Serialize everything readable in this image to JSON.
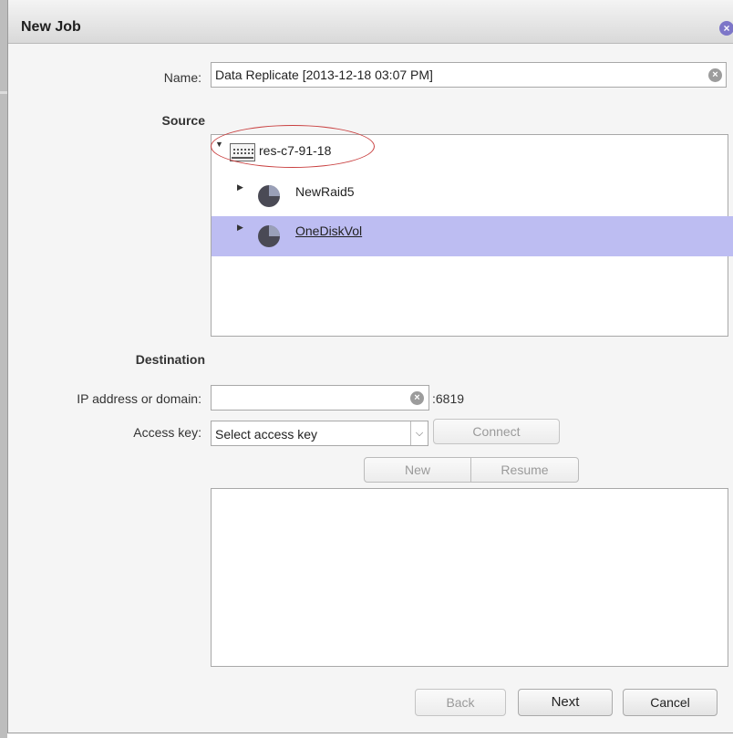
{
  "dialog": {
    "title": "New Job"
  },
  "name_field": {
    "label": "Name:",
    "value": "Data Replicate [2013-12-18 03:07 PM]"
  },
  "source": {
    "heading": "Source",
    "host": "res-c7-91-18",
    "volumes": [
      {
        "label": "NewRaid5",
        "selected": false
      },
      {
        "label": "OneDiskVol",
        "selected": true
      }
    ]
  },
  "destination": {
    "heading": "Destination",
    "ip_label": "IP address or domain:",
    "ip_value": "",
    "port": ":6819",
    "access_key_label": "Access key:",
    "access_key_selected": "Select access key",
    "connect_label": "Connect",
    "new_label": "New",
    "resume_label": "Resume"
  },
  "footer": {
    "back_label": "Back",
    "next_label": "Next",
    "cancel_label": "Cancel"
  },
  "colors": {
    "selection": "#bdbdf2",
    "close_icon": "#7d76c8",
    "annotation": "#c94040",
    "volume_icon": "#4a4a55"
  },
  "icons": [
    "close-icon",
    "clear-icon",
    "expand-icon",
    "collapse-icon",
    "server-icon",
    "volume-icon",
    "chevron-down-icon"
  ]
}
